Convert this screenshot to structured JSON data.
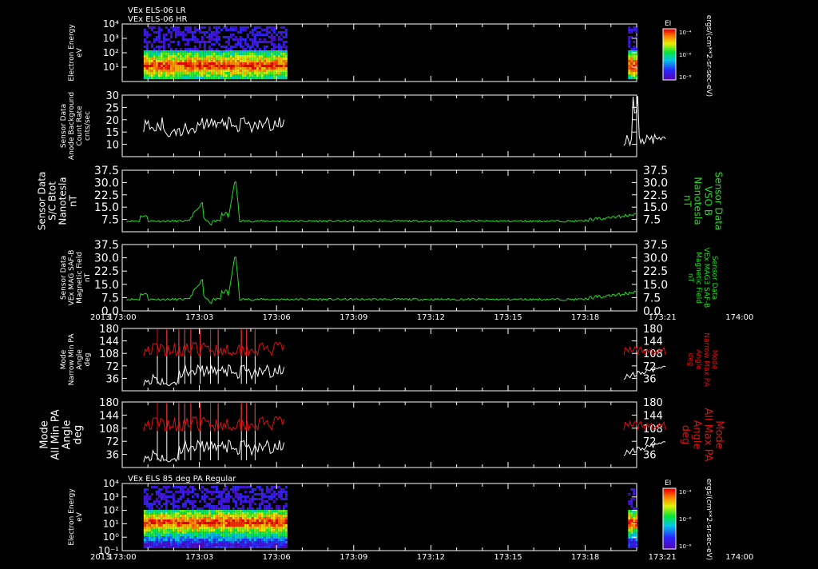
{
  "colors": {
    "white": "#ffffff",
    "green": "#22dd22",
    "red": "#dd1111",
    "axis": "#ffffff"
  },
  "time_axis": {
    "xlim": [
      0,
      60
    ],
    "tick_minutes": [
      0,
      3,
      6,
      9,
      12,
      15,
      18,
      21,
      24,
      27,
      30,
      33,
      36,
      39,
      42,
      45,
      48,
      51,
      54,
      57,
      60
    ],
    "tick_labels": [
      "173:00",
      "173:03",
      "173:06",
      "173:09",
      "173:12",
      "173:15",
      "173:18",
      "173:21",
      "174:00"
    ],
    "year_label": "2013"
  },
  "chart_data": [
    {
      "id": "panel-els-hr",
      "type": "heatmap",
      "titles": [
        "VEx ELS-06 LR",
        "VEx ELS-06 HR"
      ],
      "ylabel": [
        "Electron Energy",
        "eV"
      ],
      "ylim_log": [
        0,
        4
      ],
      "y_ticks": [
        {
          "v": 4,
          "label": "10⁴"
        },
        {
          "v": 3,
          "label": "10³"
        },
        {
          "v": 2,
          "label": "10²"
        },
        {
          "v": 1,
          "label": "10¹"
        }
      ],
      "data_ranges": [
        [
          2.5,
          19
        ],
        [
          59,
          77
        ]
      ],
      "colorbar": {
        "label": "EI",
        "ticks": [
          "10⁻⁴",
          "10⁻⁶",
          "10⁻⁸"
        ],
        "units": "ergs/(cm**2-sr-sec-eV)"
      }
    },
    {
      "id": "panel-bgcount",
      "type": "line",
      "ylabel": [
        "Sensor Data",
        "Anode Background",
        "Count Rate",
        "cnts/sec"
      ],
      "ylim": [
        5,
        30
      ],
      "y_ticks": [
        10,
        15,
        20,
        25,
        30
      ],
      "series": [
        {
          "color": "#ffffff",
          "segments": [
            [
              2.5,
              19,
              "noise17"
            ],
            [
              58.5,
              63.5,
              "spike12"
            ]
          ]
        }
      ]
    },
    {
      "id": "panel-btot",
      "type": "line",
      "ylabel": [
        "Sensor Data",
        "S/C Btot",
        "Nanotesla",
        "nT"
      ],
      "right_ylabel": [
        "Sensor Data",
        "VSO B",
        "Nanotesla",
        "nT"
      ],
      "ylim": [
        0,
        37.5
      ],
      "y_ticks": [
        7.5,
        15.0,
        22.5,
        30.0,
        37.5
      ],
      "y_tick_labels": [
        "7.5",
        "15.0",
        "22.5",
        "30.0",
        "37.5"
      ],
      "series": [
        {
          "color": "#22dd22",
          "shape": "mag"
        }
      ]
    },
    {
      "id": "panel-mag3",
      "type": "line",
      "ylabel": [
        "Sensor Data",
        "VEx MAG SAF-B",
        "Magnetic Field",
        "nT"
      ],
      "right_ylabel": [
        "Sensor Data",
        "VEx MAG3 SAF-B",
        "Magnetic Field",
        "nT"
      ],
      "ylim": [
        0,
        37.5
      ],
      "y_ticks": [
        0,
        7.5,
        15.0,
        22.5,
        30.0,
        37.5
      ],
      "y_tick_labels": [
        "0.0",
        "7.5",
        "15.0",
        "22.5",
        "30.0",
        "37.5"
      ],
      "series": [
        {
          "color": "#22dd22",
          "shape": "mag"
        }
      ]
    },
    {
      "id": "panel-narrow-pa",
      "type": "line",
      "ylabel": [
        "Mode",
        "Narrow Min PA",
        "Angle",
        "deg"
      ],
      "right_ylabel": [
        "Mode",
        "Narrow Max PA",
        "Angle",
        "deg"
      ],
      "ylim": [
        0,
        180
      ],
      "y_ticks": [
        36,
        72,
        108,
        144,
        180
      ],
      "series": [
        {
          "color": "#ffffff",
          "segments": [
            [
              2.5,
              19,
              "pamin"
            ],
            [
              58.5,
              63.5,
              "pamin2"
            ]
          ]
        },
        {
          "color": "#dd1111",
          "segments": [
            [
              2.5,
              19,
              "pamax"
            ],
            [
              58.5,
              63.5,
              "pamax2"
            ]
          ]
        }
      ]
    },
    {
      "id": "panel-all-pa",
      "type": "line",
      "ylabel": [
        "Mode",
        "All Min PA",
        "Angle",
        "deg"
      ],
      "right_ylabel": [
        "Mode",
        "All Max PA",
        "Angle",
        "deg"
      ],
      "ylim": [
        0,
        180
      ],
      "y_ticks": [
        36,
        72,
        108,
        144,
        180
      ],
      "series": [
        {
          "color": "#ffffff",
          "segments": [
            [
              2.5,
              19,
              "pamin"
            ],
            [
              58.5,
              63.5,
              "pamin2"
            ]
          ]
        },
        {
          "color": "#dd1111",
          "segments": [
            [
              2.5,
              19,
              "pamax"
            ],
            [
              58.5,
              63.5,
              "pamax2"
            ]
          ]
        }
      ]
    },
    {
      "id": "panel-els-85",
      "type": "heatmap",
      "titles": [
        "VEx ELS 85 deg PA Regular"
      ],
      "ylabel": [
        "Electron Energy",
        "eV"
      ],
      "ylim_log": [
        -1,
        4
      ],
      "y_ticks": [
        {
          "v": 4,
          "label": "10⁴"
        },
        {
          "v": 3,
          "label": "10³"
        },
        {
          "v": 2,
          "label": "10²"
        },
        {
          "v": 1,
          "label": "10¹"
        },
        {
          "v": 0,
          "label": "10⁰"
        },
        {
          "v": -1,
          "label": "10⁻¹"
        }
      ],
      "data_ranges": [
        [
          2.5,
          19
        ],
        [
          59,
          77
        ]
      ],
      "colorbar": {
        "label": "EI",
        "ticks": [
          "10⁻⁴",
          "10⁻⁶",
          "10⁻⁸"
        ],
        "units": "ergs/(cm**2-sr-sec-eV)"
      }
    }
  ]
}
